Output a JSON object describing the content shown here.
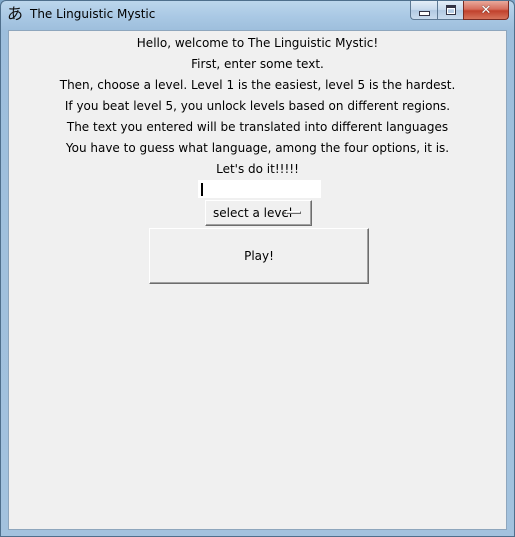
{
  "window": {
    "title": "The Linguistic Mystic",
    "app_icon_glyph": "あ",
    "buttons": {
      "minimize_icon": "minimize-icon",
      "maximize_icon": "maximize-icon",
      "close_icon": "close-icon",
      "close_glyph": "✕"
    }
  },
  "instructions": [
    "Hello, welcome to The Linguistic Mystic!",
    "First, enter some text.",
    "Then, choose a level. Level 1 is the easiest, level 5 is the hardest.",
    "If you beat level 5, you unlock levels based on different regions.",
    "The text you entered will be translated into different languages",
    "You have to guess what language, among the four options, it is.",
    "Let's do it!!!!!"
  ],
  "text_entry": {
    "value": ""
  },
  "level_menu": {
    "selected": "select a level"
  },
  "play_button": {
    "label": "Play!"
  },
  "colors": {
    "client_bg": "#f0f0f0",
    "close_button": "#c1412c",
    "titlebar": "#a9c8e4"
  }
}
